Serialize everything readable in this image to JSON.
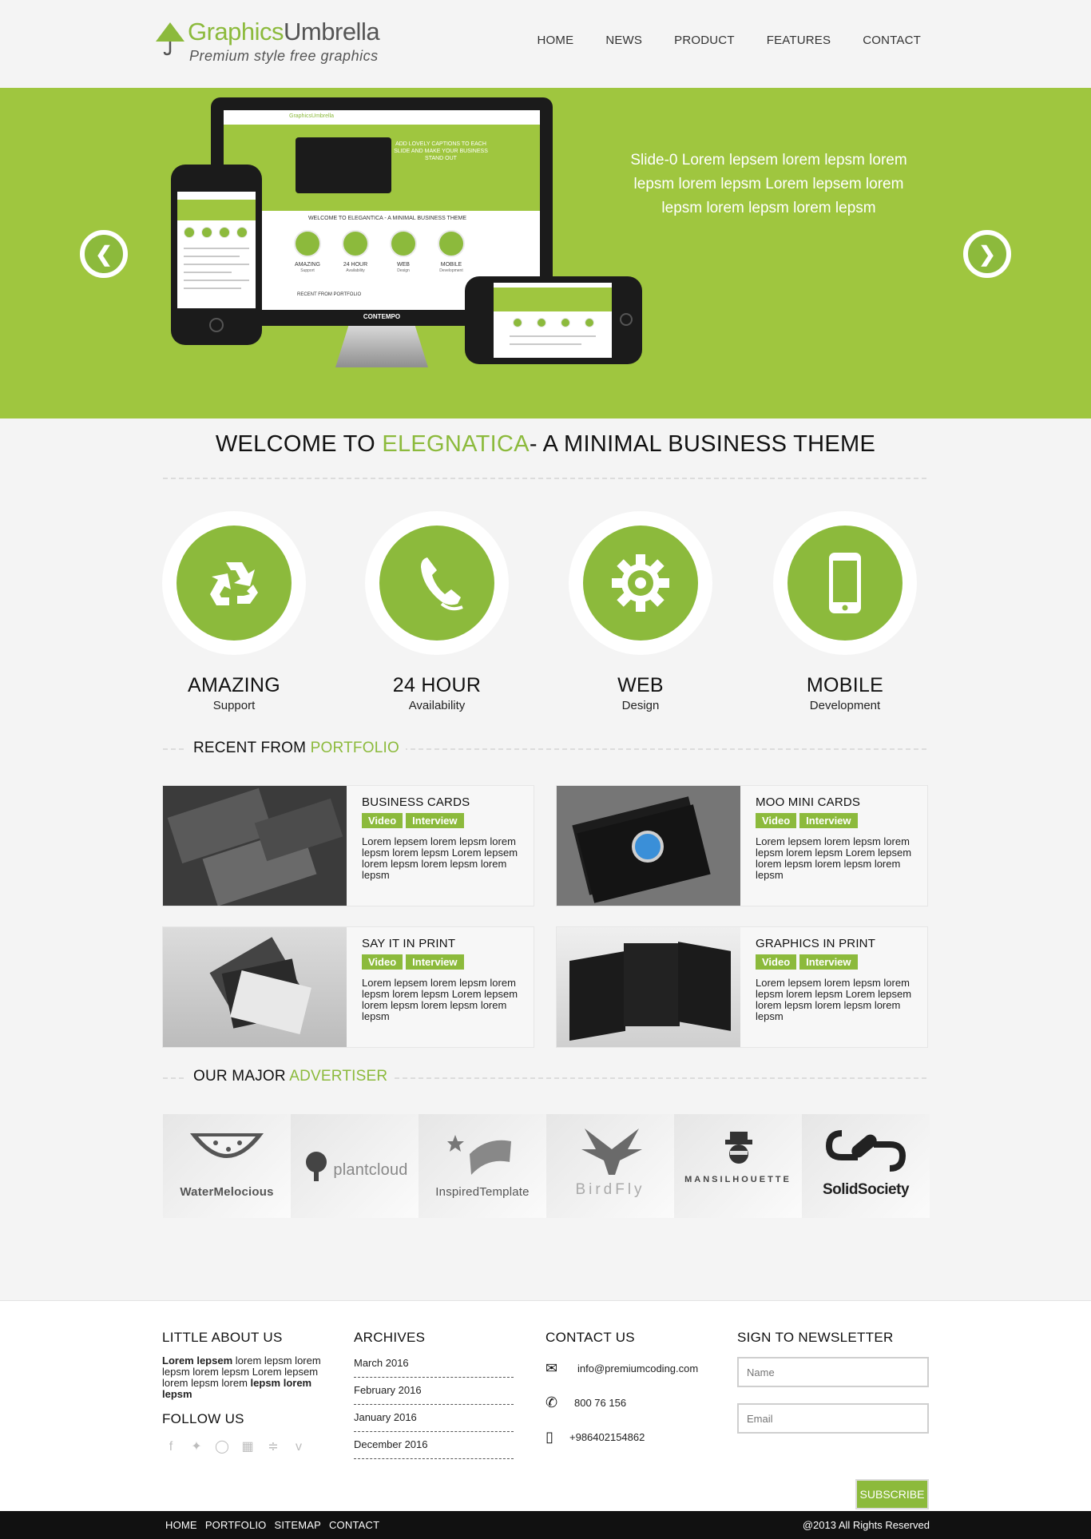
{
  "brand": {
    "name_a": "Graphics",
    "name_b": "Umbrella",
    "tagline": "Premium style free graphics"
  },
  "nav": [
    "HOME",
    "NEWS",
    "PRODUCT",
    "FEATURES",
    "CONTACT"
  ],
  "slider": {
    "caption": "Slide-0 Lorem lepsem lorem lepsm lorem lepsm lorem lepsm Lorem lepsem lorem lepsm lorem lepsm lorem lepsm",
    "prev_icon": "chevron-left-icon",
    "next_icon": "chevron-right-icon",
    "mockup": {
      "caption": "ADD LOVELY CAPTIONS TO EACH SLIDE AND MAKE YOUR BUSINESS STAND OUT",
      "welcome": "WELCOME TO ELEGANTICA - A MINIMAL BUSINESS THEME",
      "features": [
        "AMAZING",
        "24 HOUR",
        "WEB",
        "MOBILE"
      ],
      "sub": [
        "Support",
        "Availability",
        "Design",
        "Development"
      ],
      "recent": "RECENT FROM PORTFOLIO",
      "monitor_label": "CONTEMPO"
    }
  },
  "welcome": {
    "pre": "WELCOME TO ",
    "highlight": "ELEGNATICA",
    "post": "- A MINIMAL BUSINESS THEME"
  },
  "features": [
    {
      "title": "AMAZING",
      "subtitle": "Support",
      "icon": "recycle-icon"
    },
    {
      "title": "24 HOUR",
      "subtitle": "Availability",
      "icon": "phone-icon"
    },
    {
      "title": "WEB",
      "subtitle": "Design",
      "icon": "gear-icon"
    },
    {
      "title": "MOBILE",
      "subtitle": "Development",
      "icon": "mobile-icon"
    }
  ],
  "portfolio": {
    "title_pre": "RECENT FROM ",
    "title_hl": "PORTFOLIO",
    "tag_video": "Video",
    "tag_interview": "Interview",
    "items": [
      {
        "title": "BUSINESS CARDS",
        "desc": "Lorem lepsem lorem lepsm lorem lepsm lorem lepsm Lorem lepsem lorem lepsm lorem lepsm lorem lepsm"
      },
      {
        "title": "MOO MINI CARDS",
        "desc": "Lorem lepsem lorem lepsm lorem lepsm lorem lepsm Lorem lepsem lorem lepsm lorem lepsm lorem lepsm"
      },
      {
        "title": "SAY IT IN PRINT",
        "desc": "Lorem lepsem lorem lepsm lorem lepsm lorem lepsm Lorem lepsem lorem lepsm lorem lepsm lorem lepsm"
      },
      {
        "title": "GRAPHICS IN PRINT",
        "desc": "Lorem lepsem lorem lepsm lorem lepsm lorem lepsm Lorem lepsem lorem lepsm lorem lepsm lorem lepsm"
      }
    ]
  },
  "advertisers": {
    "title_pre": "OUR MAJOR ",
    "title_hl": "ADVERTISER",
    "logos": [
      "WaterMelocious",
      "plantcloud",
      "InspiredTemplate",
      "BirdFly",
      "MANSILHOUETTE",
      "SolidSociety"
    ]
  },
  "footer": {
    "about_title": "LITTLE ABOUT US",
    "about_bold1": "Lorem lepsem",
    "about_text": " lorem lepsm lorem lepsm lorem lepsm Lorem lepsem lorem lepsm lorem ",
    "about_bold2": "lepsm lorem lepsm",
    "follow_title": "FOLLOW US",
    "social": [
      "facebook-icon",
      "twitter-icon",
      "dribbble-icon",
      "windows-icon",
      "rss-icon",
      "vimeo-icon"
    ],
    "archives_title": "ARCHIVES",
    "archives": [
      "March 2016",
      "February 2016",
      "January 2016",
      "December 2016"
    ],
    "contact_title": "CONTACT US",
    "email": "info@premiumcoding.com",
    "phone": "800 76 156",
    "mobile": "+986402154862",
    "newsletter_title": "SIGN TO NEWSLETTER",
    "name_placeholder": "Name",
    "email_placeholder": "Email",
    "subscribe": "SUBSCRIBE"
  },
  "bottom": {
    "nav": [
      "HOME",
      "PORTFOLIO",
      "SITEMAP",
      "CONTACT"
    ],
    "copyright": "@2013 All Rights Reserved"
  },
  "colors": {
    "accent": "#8cba3c",
    "slider_bg": "#9fc63f",
    "page_bg": "#f4f4f4",
    "bottom_bar": "#111111"
  }
}
